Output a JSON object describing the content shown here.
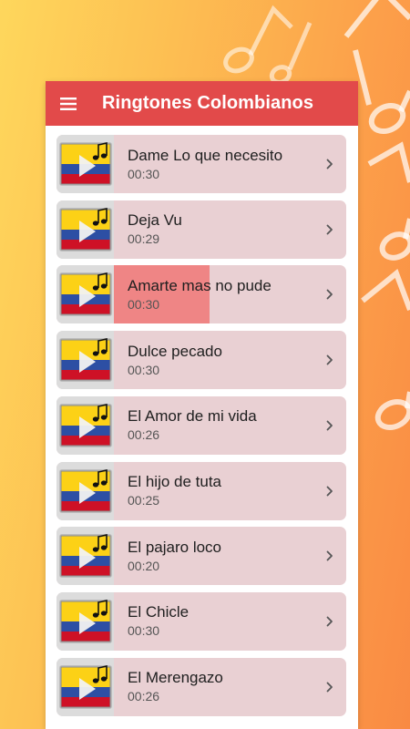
{
  "app": {
    "title": "Ringtones Colombianos",
    "colors": {
      "appbar": "#e24a4a",
      "item_bg": "#e9d0d3",
      "progress": "#ef8585",
      "flag_yellow": "#fcd116",
      "flag_blue": "#2d4fa4",
      "flag_red": "#ce1126"
    }
  },
  "toolbar": {
    "menu_icon": "hamburger-menu-icon"
  },
  "ringtones": [
    {
      "name": "Dame Lo que necesito",
      "duration": "00:30",
      "progress": 0
    },
    {
      "name": "Deja Vu",
      "duration": "00:29",
      "progress": 0
    },
    {
      "name": "Amarte mas no pude",
      "duration": "00:30",
      "progress": 0.41
    },
    {
      "name": "Dulce pecado",
      "duration": "00:30",
      "progress": 0
    },
    {
      "name": "El Amor de mi vida",
      "duration": "00:26",
      "progress": 0
    },
    {
      "name": "El hijo de tuta",
      "duration": "00:25",
      "progress": 0
    },
    {
      "name": "El pajaro loco",
      "duration": "00:20",
      "progress": 0
    },
    {
      "name": "El Chicle",
      "duration": "00:30",
      "progress": 0
    },
    {
      "name": "El Merengazo",
      "duration": "00:26",
      "progress": 0
    }
  ]
}
